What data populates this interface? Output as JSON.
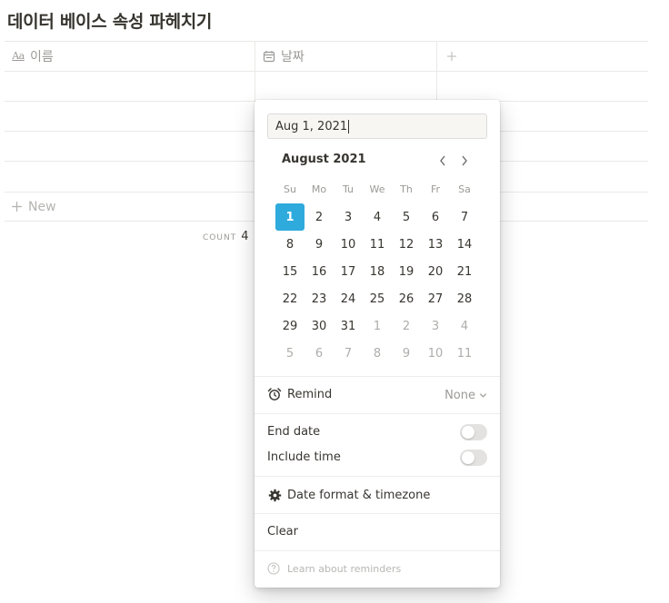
{
  "page": {
    "title": "데이터 베이스 속성 파헤치기"
  },
  "table": {
    "columns": [
      {
        "label": "이름",
        "icon": "text-property-icon"
      },
      {
        "label": "날짜",
        "icon": "calendar-icon"
      }
    ],
    "add_column_icon": "plus-icon",
    "new_row_label": "New",
    "count_label": "COUNT",
    "count_value": "4"
  },
  "date_picker": {
    "input_value": "Aug 1, 2021",
    "month_label": "August 2021",
    "weekdays": [
      "Su",
      "Mo",
      "Tu",
      "We",
      "Th",
      "Fr",
      "Sa"
    ],
    "weeks": [
      [
        "1",
        "2",
        "3",
        "4",
        "5",
        "6",
        "7"
      ],
      [
        "8",
        "9",
        "10",
        "11",
        "12",
        "13",
        "14"
      ],
      [
        "15",
        "16",
        "17",
        "18",
        "19",
        "20",
        "21"
      ],
      [
        "22",
        "23",
        "24",
        "25",
        "26",
        "27",
        "28"
      ],
      [
        "29",
        "30",
        "31",
        "1",
        "2",
        "3",
        "4"
      ],
      [
        "5",
        "6",
        "7",
        "8",
        "9",
        "10",
        "11"
      ]
    ],
    "selected_day": "1",
    "remind_label": "Remind",
    "remind_value": "None",
    "end_date_label": "End date",
    "end_date_enabled": false,
    "include_time_label": "Include time",
    "include_time_enabled": false,
    "date_format_label": "Date format & timezone",
    "clear_label": "Clear",
    "learn_label": "Learn about reminders",
    "accent_color": "#2eaadc"
  }
}
